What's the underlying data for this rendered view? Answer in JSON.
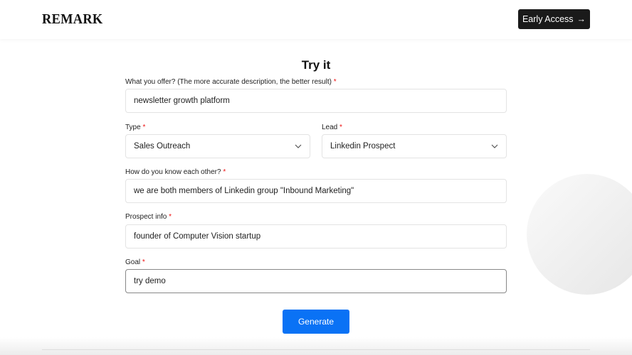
{
  "header": {
    "logo": "REMARK",
    "cta_label": "Early Access",
    "cta_icon": "arrow-right-icon"
  },
  "form": {
    "title": "Try it",
    "required_mark": "*",
    "offer": {
      "label": "What you offer? (The more accurate description, the better result)",
      "value": "newsletter growth platform"
    },
    "type": {
      "label": "Type",
      "value": "Sales Outreach"
    },
    "lead": {
      "label": "Lead",
      "value": "Linkedin Prospect"
    },
    "relation": {
      "label": "How do you know each other?",
      "value": "we are both members of Linkedin group \"Inbound Marketing\""
    },
    "prospect": {
      "label": "Prospect info",
      "value": "founder of Computer Vision startup"
    },
    "goal": {
      "label": "Goal",
      "value": "try demo"
    },
    "submit_label": "Generate"
  },
  "colors": {
    "primary": "#0a72f5",
    "dark": "#1a1a1a",
    "required": "#e11111"
  }
}
